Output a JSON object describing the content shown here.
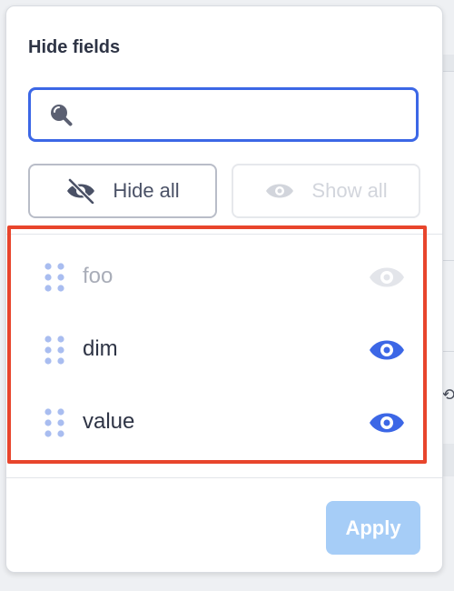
{
  "popover": {
    "title": "Hide fields",
    "search": {
      "value": "",
      "placeholder": ""
    },
    "hide_all_label": "Hide all",
    "show_all_label": "Show all",
    "apply_label": "Apply",
    "fields": [
      {
        "label": "foo",
        "visible": false
      },
      {
        "label": "dim",
        "visible": true
      },
      {
        "label": "value",
        "visible": true
      }
    ]
  },
  "colors": {
    "accent": "#3c67e6",
    "eye_active": "#3c67e6",
    "eye_inactive": "#e3e5ea",
    "drag_handle": "#a9bdf0",
    "highlight": "#e8452c",
    "apply_disabled": "#a6cdf7"
  },
  "icons": {
    "search": "search-icon",
    "hide_all": "eye-slash-icon",
    "show_all": "eye-icon",
    "drag": "drag-handle-icon",
    "toggle": "eye-icon"
  }
}
